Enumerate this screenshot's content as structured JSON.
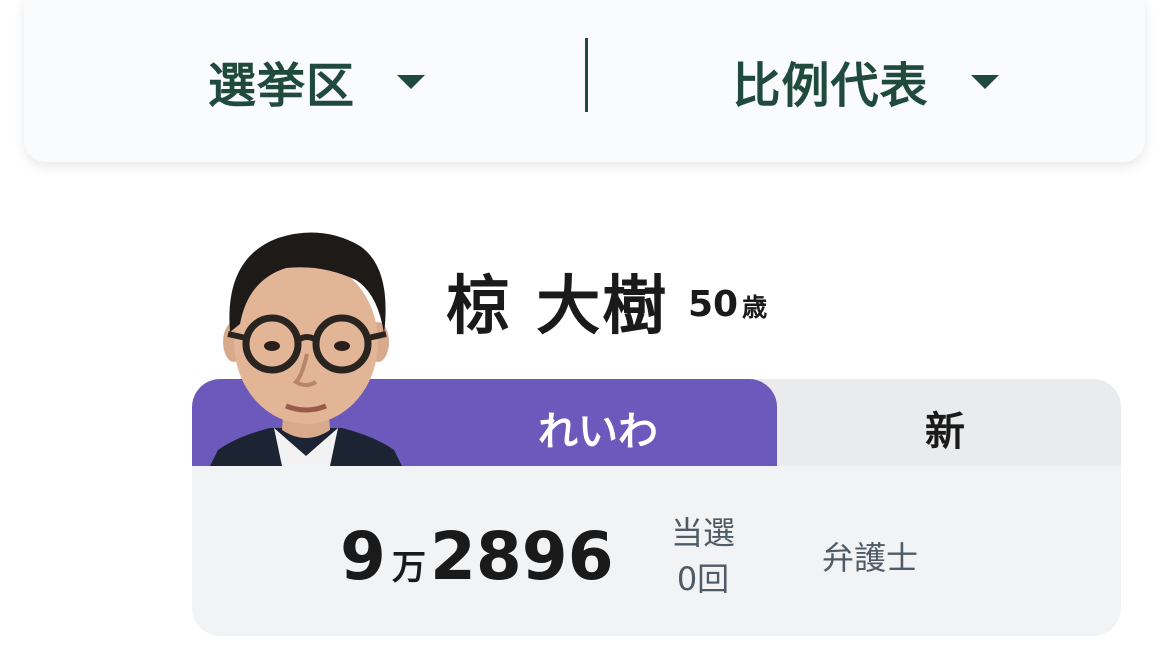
{
  "selector": {
    "district_label": "選挙区",
    "pr_label": "比例代表"
  },
  "candidate": {
    "name": "椋 大樹",
    "age_number": "50",
    "age_unit": "歳",
    "party": "れいわ",
    "status": "新",
    "votes_man": "9",
    "votes_man_unit": "万",
    "votes_rest": "2896",
    "wins_label": "当選",
    "wins_count": "0回",
    "occupation": "弁護士"
  },
  "colors": {
    "party_accent": "#6b59bc",
    "selector_text": "#1f4a3c"
  },
  "icons": {
    "dropdown": "caret-down-icon",
    "photo": "candidate-photo"
  }
}
